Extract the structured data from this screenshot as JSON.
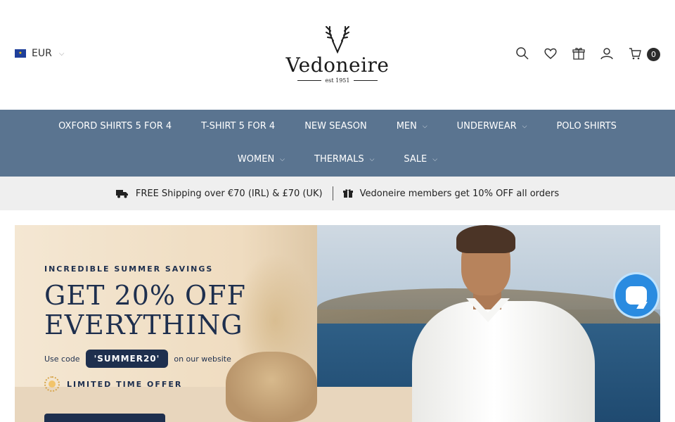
{
  "header": {
    "currency": "EUR",
    "flag_icon": "eu-flag-icon",
    "logo": {
      "word": "Vedoneire",
      "est": "est 1951"
    },
    "icons": [
      "search-icon",
      "heart-icon",
      "gift-icon",
      "account-icon",
      "cart-icon"
    ],
    "cart_count": "0"
  },
  "nav": {
    "row1": [
      {
        "label": "OXFORD SHIRTS 5 FOR 4",
        "dropdown": false
      },
      {
        "label": "T-SHIRT 5 FOR 4",
        "dropdown": false
      },
      {
        "label": "NEW SEASON",
        "dropdown": false
      },
      {
        "label": "MEN",
        "dropdown": true
      },
      {
        "label": "UNDERWEAR",
        "dropdown": true
      },
      {
        "label": "POLO SHIRTS",
        "dropdown": false
      }
    ],
    "row2": [
      {
        "label": "WOMEN",
        "dropdown": true
      },
      {
        "label": "THERMALS",
        "dropdown": true
      },
      {
        "label": "SALE",
        "dropdown": true
      }
    ]
  },
  "announcement": {
    "shipping": "FREE Shipping over €70 (IRL) & £70 (UK)",
    "members": "Vedoneire members get 10% OFF all orders"
  },
  "hero": {
    "kicker": "INCREDIBLE SUMMER SAVINGS",
    "headline_1": "GET 20% OFF",
    "headline_2": "EVERYTHING",
    "use_code": "Use code",
    "code": "'SUMMER20'",
    "on_site": "on our website",
    "limited": "LIMITED TIME OFFER"
  },
  "colors": {
    "nav_bg": "#5a7490",
    "announce_bg": "#efefef",
    "hero_navy": "#1e2f4e",
    "chat_blue": "#2a8be0"
  }
}
